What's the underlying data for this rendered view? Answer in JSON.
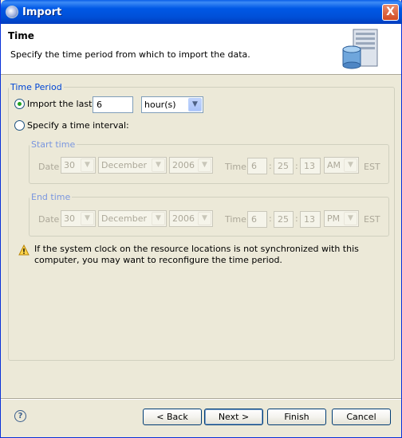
{
  "window": {
    "title": "Import",
    "close": "X"
  },
  "header": {
    "title": "Time",
    "description": "Specify the time period from which to import the data."
  },
  "period": {
    "legend": "Time Period",
    "import_last_label": "Import the last",
    "import_last_value": "6",
    "unit_value": "hour(s)",
    "specify_label": "Specify a time interval:",
    "selected": "import_last"
  },
  "start": {
    "legend": "Start time",
    "date_label": "Date",
    "day": "30",
    "month": "December",
    "year": "2006",
    "time_label": "Time",
    "hour": "6",
    "minute": "25",
    "second": "13",
    "ampm": "AM",
    "tz": "EST",
    "colon": ":"
  },
  "end": {
    "legend": "End time",
    "date_label": "Date",
    "day": "30",
    "month": "December",
    "year": "2006",
    "time_label": "Time",
    "hour": "6",
    "minute": "25",
    "second": "13",
    "ampm": "PM",
    "tz": "EST",
    "colon": ":"
  },
  "warning": "If the system clock on the resource locations is not synchronized with this computer, you may want to reconfigure the time period.",
  "footer": {
    "help": "?",
    "back": "< Back",
    "next": "Next >",
    "finish": "Finish",
    "cancel": "Cancel"
  }
}
